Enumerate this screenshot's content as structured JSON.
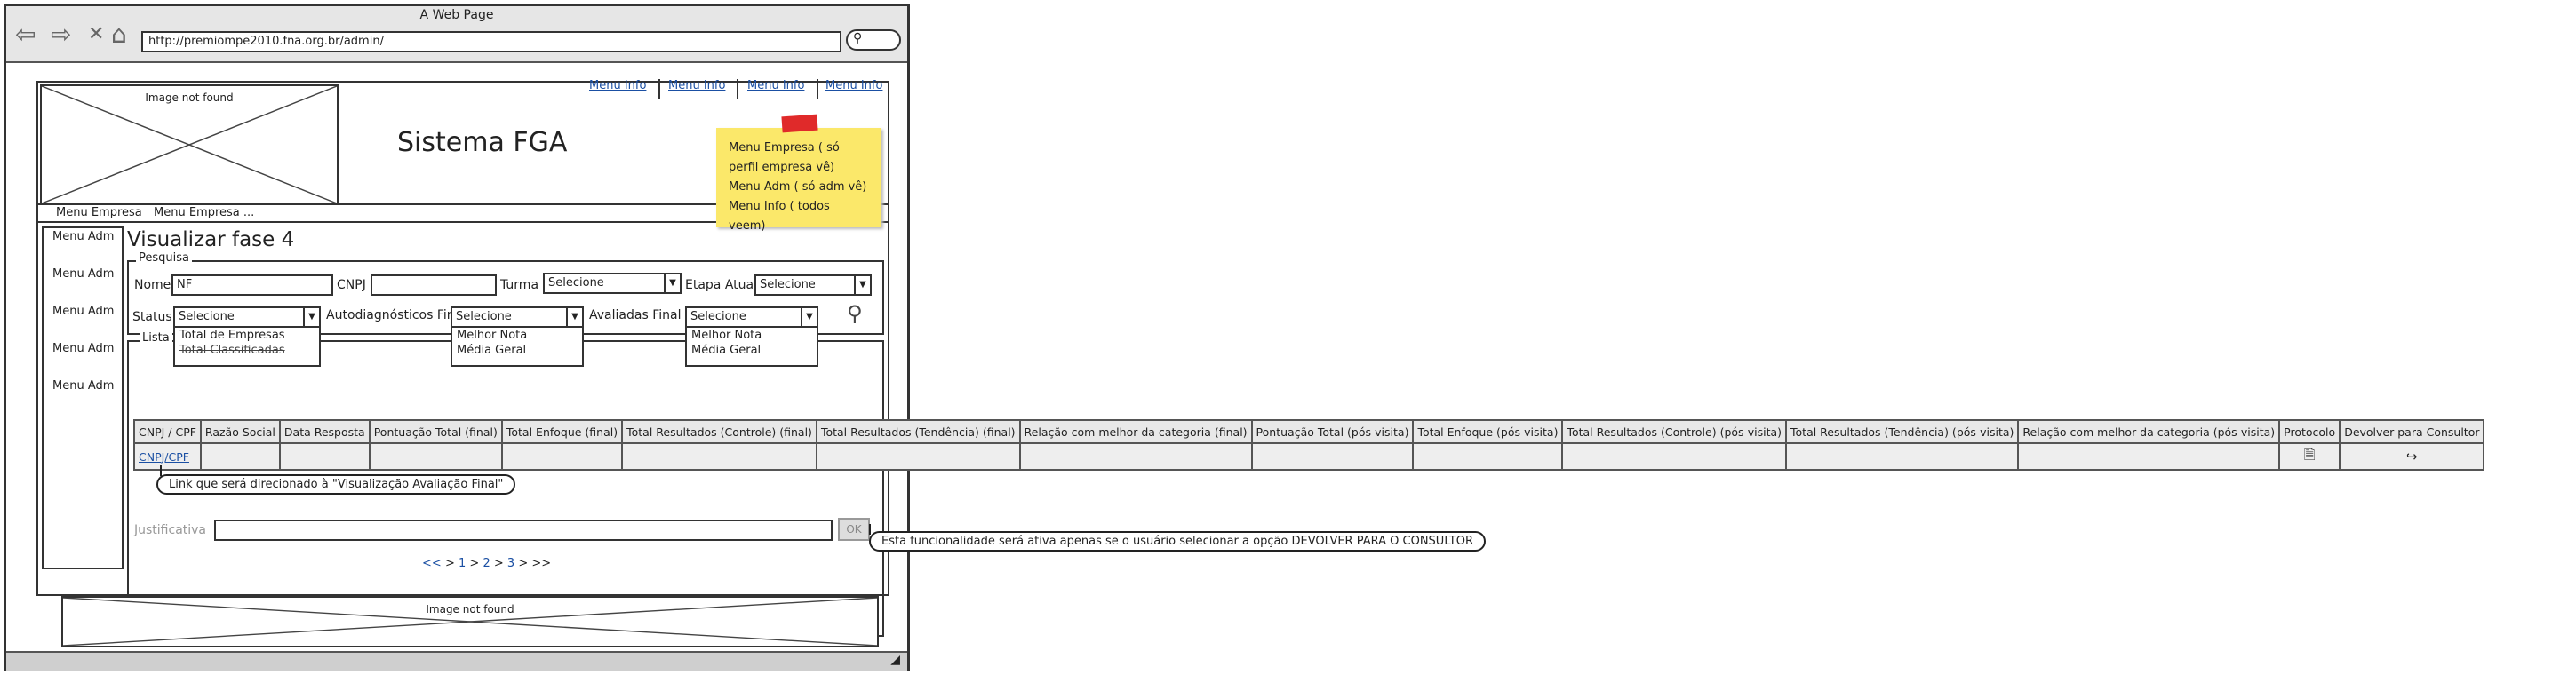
{
  "browser": {
    "window_title": "A Web Page",
    "url": "http://premiompe2010.fna.org.br/admin/"
  },
  "header": {
    "logo_caption": "Image not found",
    "site_title": "Sistema FGA",
    "top_menu": [
      "Menu Info",
      "Menu Info",
      "Menu Info",
      "Menu Info"
    ]
  },
  "menubar": {
    "items": [
      "Menu Empresa",
      "Menu Empresa ..."
    ]
  },
  "sticky_note": {
    "lines": [
      "Menu Empresa ( só perfil empresa vê)",
      "Menu Adm ( só adm vê)",
      "Menu Info ( todos veem)"
    ]
  },
  "sidebar": {
    "items": [
      "Menu Adm",
      "Menu Adm",
      "Menu Adm",
      "Menu Adm",
      "Menu Adm"
    ]
  },
  "page": {
    "title": "Visualizar fase 4"
  },
  "search": {
    "legend": "Pesquisa",
    "nome_label": "Nome",
    "nome_value": "NF",
    "cnpj_label": "CNPJ",
    "turma_label": "Turma",
    "turma_value": "Selecione",
    "etapa_label": "Etapa Atual",
    "etapa_value": "Selecione",
    "status_label": "Status",
    "status_value": "Selecione",
    "status_options": [
      "Total de Empresas",
      "Total Classificadas"
    ],
    "auto_label": "Autodiagnósticos Final",
    "auto_value": "Selecione",
    "auto_options": [
      "Melhor Nota",
      "Média Geral"
    ],
    "aval_label": "Avaliadas Final",
    "aval_value": "Selecione",
    "aval_options": [
      "Melhor Nota",
      "Média Geral"
    ]
  },
  "list": {
    "legend": "Lista",
    "columns": [
      "CNPJ / CPF",
      "Razão Social",
      "Data Resposta",
      "Pontuação Total (final)",
      "Total Enfoque (final)",
      "Total Resultados (Controle) (final)",
      "Total Resultados (Tendência) (final)",
      "Relação com melhor da categoria (final)",
      "Pontuação Total (pós-visita)",
      "Total Enfoque (pós-visita)",
      "Total Resultados (Controle) (pós-visita)",
      "Total Resultados (Tendência) (pós-visita)",
      "Relação com melhor da categoria (pós-visita)",
      "Protocolo",
      "Devolver para Consultor"
    ],
    "row": {
      "cnpj": "CNPJ/CPF"
    },
    "link_callout": "Link que será direcionado à \"Visualização Avaliação Final\"",
    "justificativa_label": "Justificativa",
    "ok_label": "OK",
    "ok_callout": "Esta funcionalidade será ativa apenas se o usuário selecionar a opção DEVOLVER PARA O CONSULTOR",
    "pager": {
      "prev": "<<",
      "p1": "1",
      "p2": "2",
      "p3": "3",
      "next": ">>",
      "sep": ">"
    }
  },
  "footer": {
    "caption": "Image not found"
  }
}
